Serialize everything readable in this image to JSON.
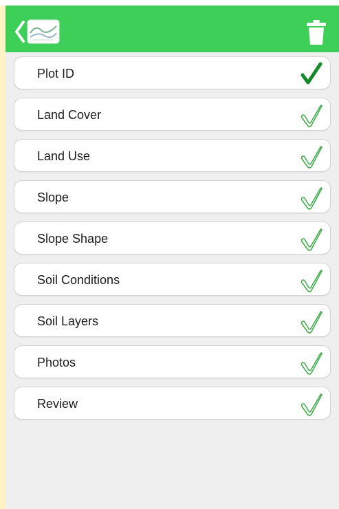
{
  "header": {
    "back_icon": "chevron-left-icon",
    "logo_icon": "landscape-logo-icon",
    "delete_icon": "trash-icon",
    "background_color": "#3ecf59"
  },
  "sections": [
    {
      "label": "Plot ID",
      "status": "complete"
    },
    {
      "label": "Land Cover",
      "status": "pending"
    },
    {
      "label": "Land Use",
      "status": "pending"
    },
    {
      "label": "Slope",
      "status": "pending"
    },
    {
      "label": "Slope Shape",
      "status": "pending"
    },
    {
      "label": "Soil Conditions",
      "status": "pending"
    },
    {
      "label": "Soil Layers",
      "status": "pending"
    },
    {
      "label": "Photos",
      "status": "pending"
    },
    {
      "label": "Review",
      "status": "pending"
    }
  ],
  "colors": {
    "check_complete": "#14892a",
    "check_pending": "#3aaa45"
  }
}
